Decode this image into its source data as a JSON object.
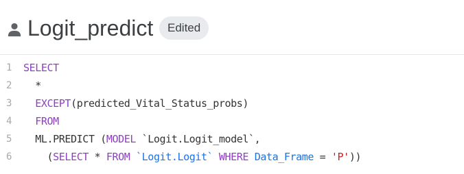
{
  "header": {
    "title": "Logit_predict",
    "badge": "Edited",
    "icon": "person-icon"
  },
  "editor": {
    "lines": [
      {
        "num": "1",
        "indent": "",
        "tokens": [
          {
            "t": "kw",
            "v": "SELECT"
          }
        ]
      },
      {
        "num": "2",
        "indent": "  ",
        "tokens": [
          {
            "t": "plain",
            "v": "*"
          }
        ]
      },
      {
        "num": "3",
        "indent": "  ",
        "tokens": [
          {
            "t": "kw",
            "v": "EXCEPT"
          },
          {
            "t": "plain",
            "v": "(predicted_Vital_Status_probs)"
          }
        ]
      },
      {
        "num": "4",
        "indent": "  ",
        "tokens": [
          {
            "t": "kw",
            "v": "FROM"
          }
        ]
      },
      {
        "num": "5",
        "indent": "  ",
        "tokens": [
          {
            "t": "plain",
            "v": "ML.PREDICT ("
          },
          {
            "t": "kw",
            "v": "MODEL"
          },
          {
            "t": "plain",
            "v": " `Logit.Logit_model`,"
          }
        ]
      },
      {
        "num": "6",
        "indent": "    ",
        "tokens": [
          {
            "t": "plain",
            "v": "("
          },
          {
            "t": "kw",
            "v": "SELECT"
          },
          {
            "t": "plain",
            "v": " * "
          },
          {
            "t": "kw",
            "v": "FROM"
          },
          {
            "t": "plain",
            "v": " "
          },
          {
            "t": "str",
            "v": "`Logit.Logit`"
          },
          {
            "t": "plain",
            "v": " "
          },
          {
            "t": "kw",
            "v": "WHERE"
          },
          {
            "t": "plain",
            "v": " "
          },
          {
            "t": "str",
            "v": "Data_Frame"
          },
          {
            "t": "plain",
            "v": " = "
          },
          {
            "t": "lit",
            "v": "'P'"
          },
          {
            "t": "plain",
            "v": "))"
          }
        ]
      }
    ]
  },
  "colors": {
    "keyword": "#8e3fbf",
    "identifier": "#1a73e8",
    "string": "#c5221f",
    "text": "#333333",
    "line_number": "#a8a8a8",
    "badge_bg": "#e8eaed"
  }
}
